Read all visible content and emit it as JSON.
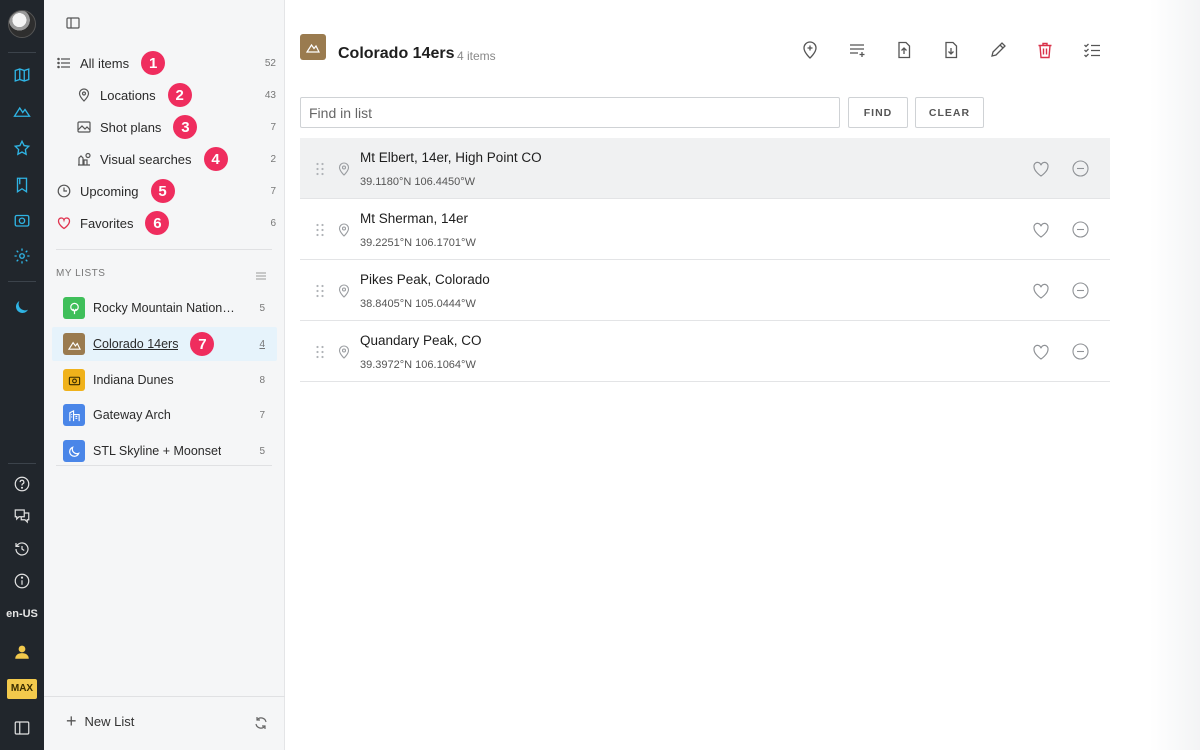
{
  "rail": {
    "icons": [
      "map-icon",
      "mountains-icon",
      "star-icon",
      "bookmark-icon",
      "camera-icon",
      "gear-icon",
      "moon-icon",
      "help-icon",
      "chat-icon",
      "history-icon",
      "info-icon",
      "user-icon",
      "panel-icon"
    ],
    "language": "en-US",
    "plan_badge": "MAX"
  },
  "sidebar": {
    "nav": [
      {
        "label": "All items",
        "count": "52",
        "badge": "1",
        "icon": "list-icon"
      },
      {
        "label": "Locations",
        "count": "43",
        "badge": "2",
        "icon": "pin-icon"
      },
      {
        "label": "Shot plans",
        "count": "7",
        "badge": "3",
        "icon": "image-icon"
      },
      {
        "label": "Visual searches",
        "count": "2",
        "badge": "4",
        "icon": "visual-search-icon"
      },
      {
        "label": "Upcoming",
        "count": "7",
        "badge": "5",
        "icon": "clock-icon"
      },
      {
        "label": "Favorites",
        "count": "6",
        "badge": "6",
        "icon": "heart-icon"
      }
    ],
    "my_lists_label": "MY LISTS",
    "lists": [
      {
        "label": "Rocky Mountain National Park",
        "count": "5",
        "color": "#3fbf5a",
        "icon": "tree-icon"
      },
      {
        "label": "Colorado 14ers",
        "count": "4",
        "color": "#9a7b4f",
        "icon": "mountains-icon",
        "badge": "7",
        "active": true
      },
      {
        "label": "Indiana Dunes",
        "count": "8",
        "color": "#f0b21b",
        "icon": "camera-icon"
      },
      {
        "label": "Gateway Arch",
        "count": "7",
        "color": "#4a86e8",
        "icon": "building-icon"
      },
      {
        "label": "STL Skyline + Moonset",
        "count": "5",
        "color": "#4a86e8",
        "icon": "moon-icon"
      }
    ],
    "new_list_label": "New List"
  },
  "main": {
    "title": "Colorado 14ers",
    "item_count": "4 items",
    "toolbar": [
      "add-location-icon",
      "add-to-list-icon",
      "export-icon",
      "import-icon",
      "edit-icon",
      "delete-icon",
      "checklist-icon"
    ],
    "search": {
      "placeholder": "Find in list",
      "value": ""
    },
    "find_label": "FIND",
    "clear_label": "CLEAR",
    "items": [
      {
        "title": "Mt Elbert, 14er, High Point CO",
        "coords": "39.1180°N 106.4450°W"
      },
      {
        "title": "Mt Sherman, 14er",
        "coords": "39.2251°N 106.1701°W"
      },
      {
        "title": "Pikes Peak, Colorado",
        "coords": "38.8405°N 105.0444°W"
      },
      {
        "title": "Quandary Peak, CO",
        "coords": "39.3972°N 106.1064°W"
      }
    ]
  },
  "colors": {
    "accent": "#1fa5d6",
    "badge": "#ef2d5e",
    "delete": "#d9324a"
  }
}
